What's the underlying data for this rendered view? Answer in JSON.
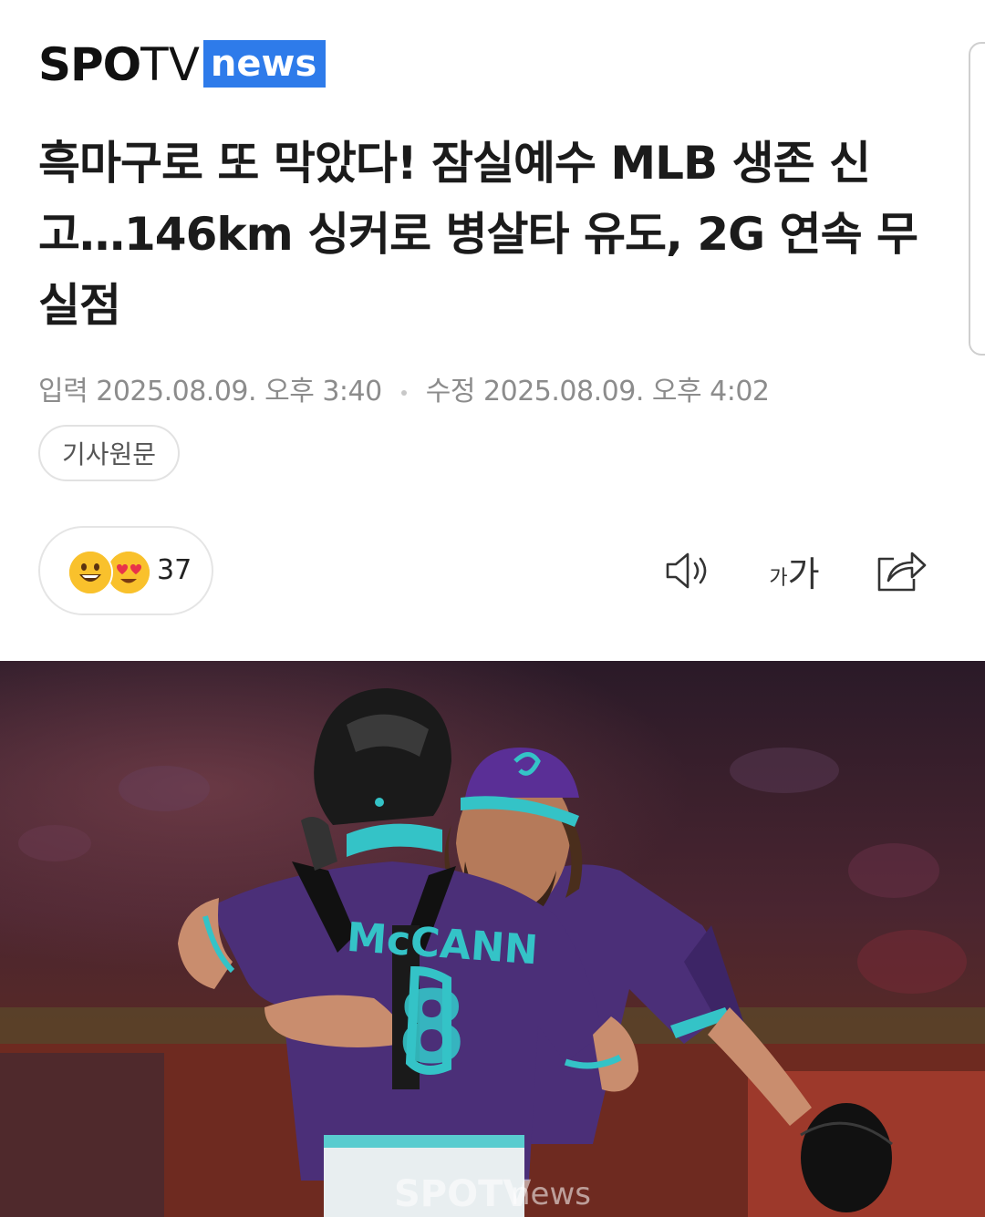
{
  "brand": {
    "logo_bold": "SPO",
    "logo_light": "TV",
    "logo_badge": "news"
  },
  "article": {
    "headline": "흑마구로 또 막았다! 잠실예수 MLB 생존 신고…146km 싱커로 병살타 유도, 2G 연속 무실점",
    "published_label": "입력",
    "published": "2025.08.09. 오후 3:40",
    "modified_label": "수정",
    "modified": "2025.08.09. 오후 4:02",
    "source_button": "기사원문"
  },
  "reactions": {
    "count": "37",
    "emojis": [
      "grinning-face",
      "heart-eyes-face"
    ]
  },
  "toolbar": {
    "icons": [
      "speaker-icon",
      "font-size-icon",
      "share-icon"
    ],
    "font_small": "가",
    "font_big": "가"
  },
  "photo": {
    "jersey_name": "McCANN",
    "jersey_number": "8",
    "watermark_bold": "SPOTV",
    "watermark_light": "news"
  },
  "colors": {
    "brand_blue": "#2e7bea",
    "jersey_purple": "#4b2f78",
    "teal": "#34c3c7"
  }
}
